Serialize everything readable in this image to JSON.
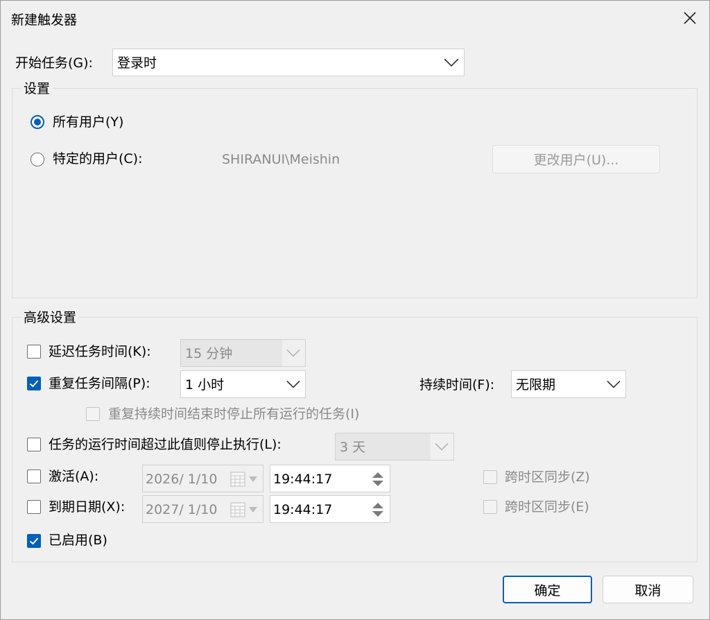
{
  "window": {
    "title": "新建触发器"
  },
  "begin": {
    "label": "开始任务(G):",
    "value": "登录时"
  },
  "settings": {
    "title": "设置",
    "all_users_label": "所有用户(Y)",
    "specific_user_label": "特定的用户(C):",
    "user_name": "SHIRANUI\\Meishin",
    "change_user_label": "更改用户(U)..."
  },
  "advanced": {
    "title": "高级设置",
    "delay": {
      "label": "延迟任务时间(K):",
      "value": "15 分钟"
    },
    "repeat": {
      "label": "重复任务间隔(P):",
      "value": "1 小时",
      "duration_label": "持续时间(F):",
      "duration_value": "无限期"
    },
    "stop_all": {
      "label": "重复持续时间结束时停止所有运行的任务(I)"
    },
    "stop_longer": {
      "label": "任务的运行时间超过此值则停止执行(L):",
      "value": "3 天"
    },
    "activate": {
      "label": "激活(A):",
      "date": "2026/  1/10",
      "time": "19:44:17",
      "sync_label": "跨时区同步(Z)"
    },
    "expire": {
      "label": "到期日期(X):",
      "date": "2027/  1/10",
      "time": "19:44:17",
      "sync_label": "跨时区同步(E)"
    },
    "enabled": {
      "label": "已启用(B)"
    }
  },
  "buttons": {
    "ok": "确定",
    "cancel": "取消"
  },
  "colors": {
    "accent": "#005fb8",
    "background": "#f0f0f0",
    "disabled_text": "#8a8a8a"
  }
}
